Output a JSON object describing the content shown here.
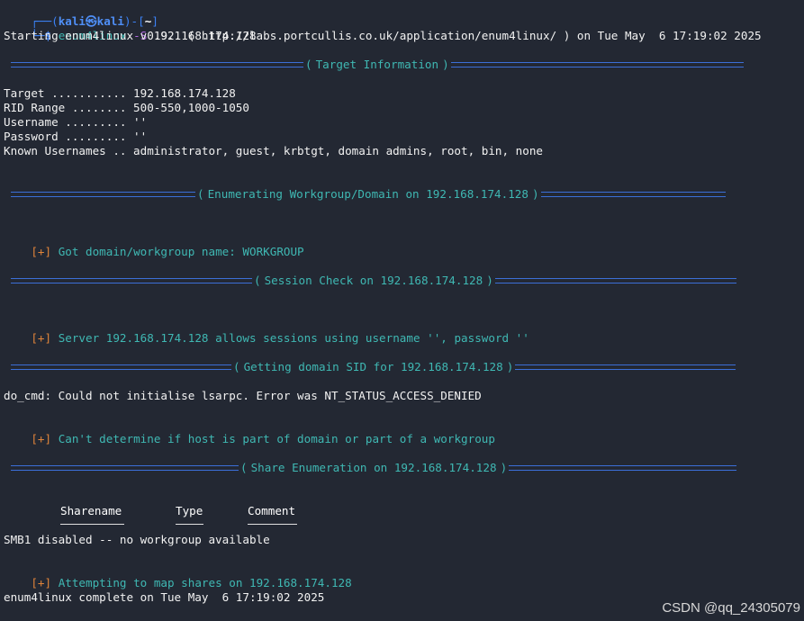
{
  "prompt": {
    "corner_top": "┌──(",
    "user": "kali",
    "at_symbol": "㉿",
    "host": "kali",
    "mid": ")-[",
    "cwd": "~",
    "end": "]",
    "corner_bottom": "└─",
    "dollar": "$",
    "command": "enum4linux",
    "flag": "-S",
    "target_arg": "192.168.174.128"
  },
  "starting_line": "Starting enum4linux v0.9.1 ( http://labs.portcullis.co.uk/application/enum4linux/ ) on Tue May  6 17:19:02 2025",
  "sections": {
    "target_info": "Target Information",
    "workgroup": "Enumerating Workgroup/Domain on 192.168.174.128",
    "session": "Session Check on 192.168.174.128",
    "domain_sid": "Getting domain SID for 192.168.174.128",
    "shares": "Share Enumeration on 192.168.174.128"
  },
  "target_info": {
    "target": "Target ........... 192.168.174.128",
    "rid_range": "RID Range ........ 500-550,1000-1050",
    "username": "Username ......... ''",
    "password": "Password ......... ''",
    "known_users": "Known Usernames .. administrator, guest, krbtgt, domain admins, root, bin, none"
  },
  "results": {
    "marker": "[+]",
    "workgroup_name": "Got domain/workgroup name: WORKGROUP",
    "session_ok": "Server 192.168.174.128 allows sessions using username '', password ''",
    "lsarpc_error": "do_cmd: Could not initialise lsarpc. Error was NT_STATUS_ACCESS_DENIED",
    "cant_determine": "Can't determine if host is part of domain or part of a workgroup",
    "smb1": "SMB1 disabled -- no workgroup available",
    "map_shares": "Attempting to map shares on 192.168.174.128",
    "complete": "enum4linux complete on Tue May  6 17:19:02 2025"
  },
  "share_table": {
    "columns": [
      "Sharename",
      "Type",
      "Comment"
    ]
  },
  "watermark": "CSDN @qq_24305079",
  "colors": {
    "background": "#232833",
    "accent_blue": "#3b82f6",
    "teal": "#3fb8b3",
    "orange": "#e0843a",
    "purple": "#b16ae0"
  }
}
